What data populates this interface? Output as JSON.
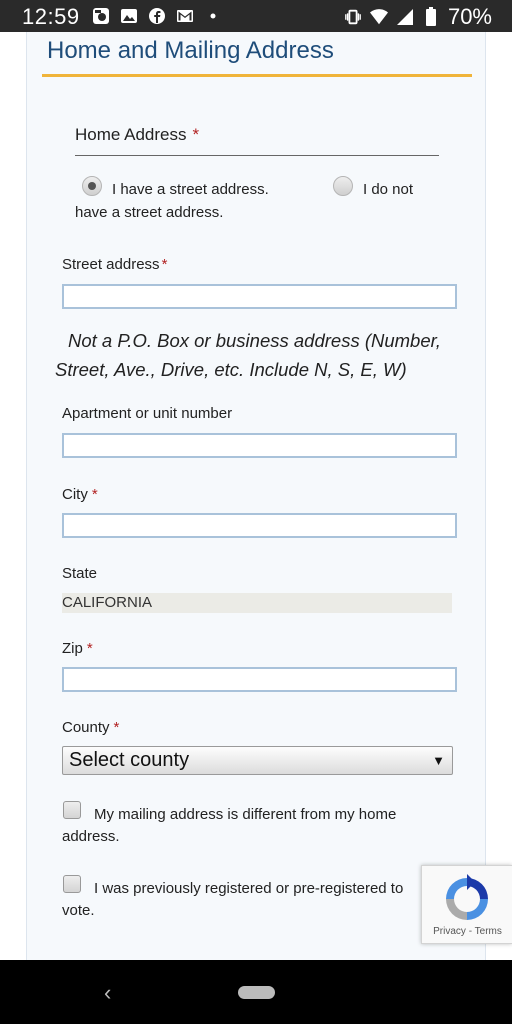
{
  "status_bar": {
    "time": "12:59",
    "battery": "70%",
    "left_icons": [
      "photos-icon",
      "image-icon",
      "facebook-icon",
      "gmail-icon",
      "dot-icon"
    ],
    "right_icons": [
      "vibrate-icon",
      "wifi-icon",
      "signal-icon",
      "battery-icon"
    ]
  },
  "section": {
    "title": "Home and Mailing Address"
  },
  "home_address": {
    "label": "Home Address",
    "required_mark": "*",
    "radio_street": "I have a street address.",
    "radio_none_line1": "I do not",
    "radio_none_line2": "have a street address."
  },
  "fields": {
    "street": {
      "label": "Street address",
      "required_mark": "*",
      "value": ""
    },
    "street_hint_line1": "Not a P.O. Box or business address (Number,",
    "street_hint_line2": "Street, Ave., Drive, etc. Include N, S, E, W)",
    "apartment": {
      "label": "Apartment or unit number",
      "value": ""
    },
    "city": {
      "label": "City",
      "required_mark": "*",
      "value": ""
    },
    "state": {
      "label": "State",
      "value": "CALIFORNIA"
    },
    "zip": {
      "label": "Zip",
      "required_mark": "*",
      "value": ""
    },
    "county": {
      "label": "County",
      "required_mark": "*",
      "selected": "Select county"
    }
  },
  "checkboxes": {
    "mailing_different": "My mailing address is different from my home address.",
    "previously_registered": "I was previously registered or pre-registered to vote."
  },
  "recaptcha": {
    "links": "Privacy - Terms"
  },
  "colors": {
    "accent_title": "#1f4d7a",
    "rule": "#f0b43a",
    "required": "#b22222"
  }
}
